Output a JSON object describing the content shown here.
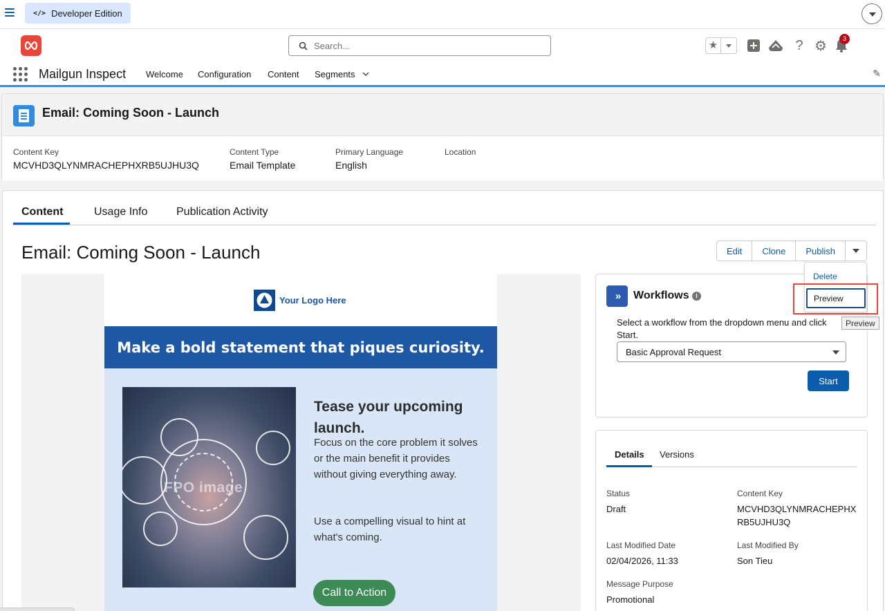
{
  "devbar": {
    "edition_label": "Developer Edition",
    "code_glyph": "</>"
  },
  "header": {
    "search_placeholder": "Search...",
    "notification_count": "3",
    "icons": [
      "favorites-star-icon",
      "add-icon",
      "trailhead-icon",
      "help-icon",
      "setup-gear-icon",
      "notifications-bell-icon"
    ]
  },
  "appnav": {
    "app_name": "Mailgun Inspect",
    "items": [
      "Welcome",
      "Configuration",
      "Content",
      "Segments"
    ]
  },
  "record": {
    "title": "Email: Coming Soon - Launch",
    "fields": [
      {
        "label": "Content Key",
        "value": "MCVHD3QLYNMRACHEPHXRB5UJHU3Q"
      },
      {
        "label": "Content Type",
        "value": "Email Template"
      },
      {
        "label": "Primary Language",
        "value": "English"
      },
      {
        "label": "Location",
        "value": ""
      }
    ]
  },
  "tabs": [
    "Content",
    "Usage Info",
    "Publication Activity"
  ],
  "content": {
    "title": "Email: Coming Soon - Launch",
    "actions": [
      "Edit",
      "Clone",
      "Publish"
    ]
  },
  "dropdown_menu": {
    "items": [
      "Delete",
      "Preview"
    ],
    "tooltip": "Preview"
  },
  "email": {
    "logo_text": "Your Logo Here",
    "banner": "Make a bold statement that piques curiosity.",
    "image_stamp": "FPO image",
    "heading": "Tease your upcoming launch.",
    "para1": "Focus on the core problem it solves or the main benefit it provides without giving everything away.",
    "para2": "Use a compelling visual to hint at what's coming.",
    "cta": "Call to Action"
  },
  "workflows": {
    "title": "Workflows",
    "description": "Select a workflow from the dropdown menu and click Start.",
    "selected": "Basic Approval Request",
    "start_label": "Start"
  },
  "details": {
    "tabs": [
      "Details",
      "Versions"
    ],
    "fields": {
      "status": {
        "label": "Status",
        "value": "Draft"
      },
      "content_key": {
        "label": "Content Key",
        "value": "MCVHD3QLYNMRACHEPHXRB5UJHU3Q"
      },
      "last_modified_date": {
        "label": "Last Modified Date",
        "value": "02/04/2026, 11:33"
      },
      "last_modified_by": {
        "label": "Last Modified By",
        "value": "Son Tieu"
      },
      "message_purpose": {
        "label": "Message Purpose",
        "value": "Promotional"
      }
    }
  },
  "colors": {
    "brand_blue": "#0b5cab",
    "accent_red": "#e8463b",
    "banner_blue": "#1e58a4",
    "cta_green": "#3c8a55"
  }
}
